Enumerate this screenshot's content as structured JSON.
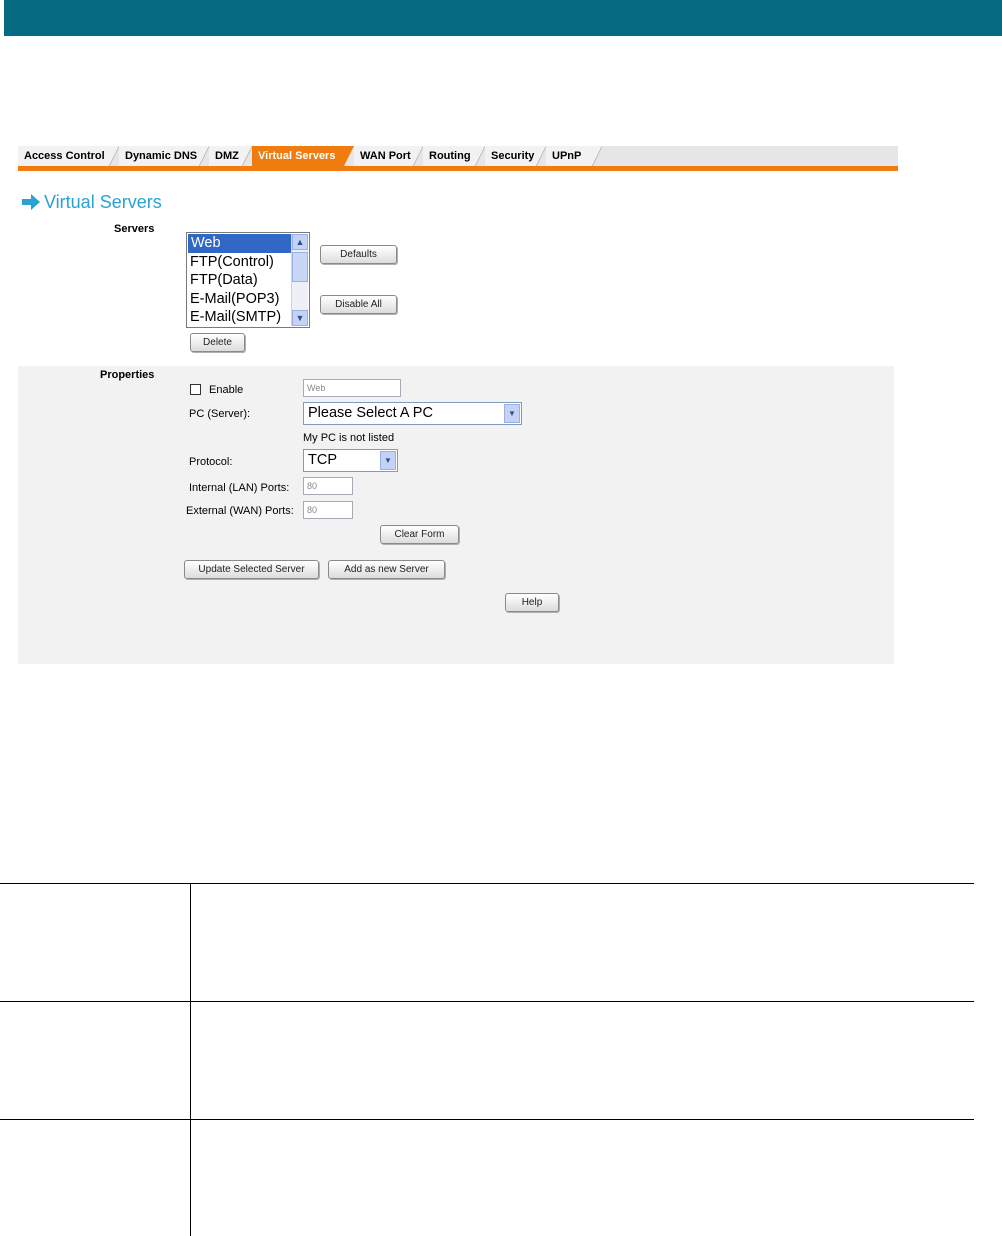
{
  "header": {
    "bar_color": "#066a82"
  },
  "tabs": [
    {
      "label": "Access Control"
    },
    {
      "label": "Dynamic DNS"
    },
    {
      "label": "DMZ"
    },
    {
      "label": "Virtual Servers",
      "active": true
    },
    {
      "label": "WAN Port"
    },
    {
      "label": "Routing"
    },
    {
      "label": "Security"
    },
    {
      "label": "UPnP"
    }
  ],
  "section": {
    "title": "Virtual Servers",
    "icon": "arrow-right-icon",
    "accent": "#2aa1d3"
  },
  "servers": {
    "label": "Servers",
    "items": [
      "Web",
      "FTP(Control)",
      "FTP(Data)",
      "E-Mail(POP3)",
      "E-Mail(SMTP)"
    ],
    "selected": "Web",
    "defaults_button": "Defaults",
    "disable_all_button": "Disable All",
    "delete_button": "Delete"
  },
  "properties": {
    "label": "Properties",
    "enable_label": "Enable",
    "enable_checked": false,
    "name_value": "Web",
    "pc_label": "PC (Server):",
    "pc_select": "Please Select A PC",
    "pc_note": "My PC is not listed",
    "protocol_label": "Protocol:",
    "protocol_select": "TCP",
    "lan_label": "Internal (LAN) Ports:",
    "lan_value": "80",
    "wan_label": "External (WAN) Ports:",
    "wan_value": "80",
    "clear_button": "Clear Form",
    "update_button": "Update Selected Server",
    "add_button": "Add as new Server",
    "help_button": "Help"
  }
}
